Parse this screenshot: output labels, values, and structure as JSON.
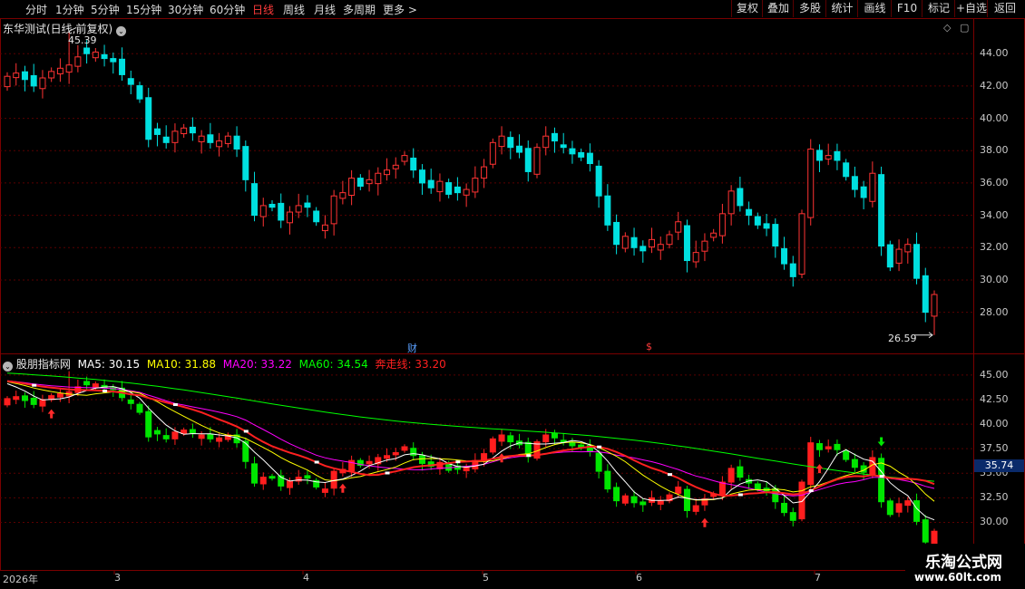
{
  "toolbar": {
    "left_items": [
      "分时",
      "1分钟",
      "5分钟",
      "15分钟",
      "30分钟",
      "60分钟",
      "日线",
      "周线",
      "月线",
      "多周期",
      "更多 >"
    ],
    "active_item": "日线",
    "right_items": [
      "复权",
      "叠加",
      "多股",
      "统计",
      "画线",
      "F10",
      "标记",
      "+自选",
      "返回"
    ]
  },
  "main_chart": {
    "title": "东华测试(日线,前复权)",
    "high_label": "45.39",
    "low_label": "26.59",
    "yaxis_ticks": [
      "44.00",
      "42.00",
      "40.00",
      "38.00",
      "36.00",
      "34.00",
      "32.00",
      "30.00",
      "28.00"
    ],
    "markers": {
      "cai": "财",
      "dollar": "$"
    }
  },
  "indicator": {
    "name": "股朋指标网",
    "ma5": "MA5: 30.15",
    "ma10": "MA10: 31.88",
    "ma20": "MA20: 33.22",
    "ma60": "MA60: 34.54",
    "benzou": "奔走线: 33.20",
    "yaxis_ticks": [
      "45.00",
      "42.50",
      "40.00",
      "37.50",
      "35.00",
      "32.50",
      "30.00"
    ],
    "current_value": "35.74"
  },
  "time_axis": [
    "2026年",
    "3",
    "4",
    "5",
    "6",
    "7"
  ],
  "watermark": {
    "name": "乐淘公式网",
    "url": "www.60lt.com"
  },
  "colors": {
    "up": "#ff3333",
    "down": "#00e0e0",
    "ind_up": "#ff1e1e",
    "ind_down": "#00e600",
    "ma5": "#ffffff",
    "ma10": "#ffff00",
    "ma20": "#ff00ff",
    "ma60": "#00ff00",
    "benzou": "#ff2020"
  },
  "chart_data": {
    "type": "candlestick",
    "closes": [
      42.6,
      42.8,
      42.4,
      42.0,
      42.5,
      42.9,
      43.1,
      43.3,
      43.8,
      44.0,
      44.1,
      43.7,
      43.5,
      42.7,
      42.1,
      41.2,
      38.7,
      39.0,
      38.5,
      39.2,
      39.4,
      39.1,
      38.9,
      38.5,
      38.6,
      38.9,
      38.1,
      36.2,
      34.0,
      34.6,
      34.5,
      33.7,
      34.2,
      34.6,
      34.5,
      33.6,
      33.4,
      35.2,
      35.4,
      36.3,
      35.8,
      36.2,
      36.6,
      36.8,
      37.1,
      37.7,
      36.8,
      36.0,
      35.7,
      36.1,
      35.3,
      35.4,
      35.6,
      36.3,
      37.0,
      38.5,
      38.9,
      38.2,
      37.9,
      36.7,
      38.2,
      38.9,
      38.6,
      38.2,
      37.8,
      37.6,
      37.2,
      35.2,
      33.4,
      32.2,
      32.7,
      32.0,
      31.8,
      32.5,
      32.2,
      32.8,
      33.6,
      31.2,
      31.7,
      32.4,
      32.9,
      34.1,
      35.5,
      34.6,
      34.0,
      33.4,
      33.2,
      32.1,
      31.0,
      30.2,
      34.1,
      38.1,
      37.4,
      37.7,
      37.4,
      36.4,
      35.6,
      35.1,
      36.6,
      32.1,
      30.8,
      31.9,
      32.2,
      30.1,
      28.0,
      29.1
    ],
    "high_marker": 45.39,
    "low_marker": 26.59,
    "ylim": [
      26.0,
      46.3
    ]
  }
}
